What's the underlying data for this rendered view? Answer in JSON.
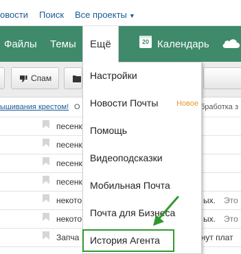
{
  "toplinks": {
    "news": "овости",
    "search": "Поиск",
    "all_projects": "Все проекты"
  },
  "nav": {
    "files": "Файлы",
    "topics": "Темы",
    "more": "Ещё",
    "calendar_day": "20",
    "calendar": "Календарь"
  },
  "toolbar": {
    "spam": "Спам"
  },
  "infostrip": {
    "link_text": "ышивания крестом!",
    "mid_text": "О",
    "right_text": "бработка з"
  },
  "rows": [
    {
      "subject": "песенк",
      "tail": "",
      "tail2": ""
    },
    {
      "subject": "песенк",
      "tail": "",
      "tail2": ""
    },
    {
      "subject": "песенк",
      "tail": "",
      "tail2": ""
    },
    {
      "subject": "песенк",
      "tail": "",
      "tail2": ""
    },
    {
      "subject": "некото",
      "tail": "ых.",
      "tail2": "Это"
    },
    {
      "subject": "некото",
      "tail": "ых.",
      "tail2": "Это"
    },
    {
      "subject": "Запча",
      "tail": "анут плат",
      "tail2": ""
    }
  ],
  "menu": {
    "items": [
      {
        "label": "Настройки"
      },
      {
        "label": "Новости Почты",
        "badge": "Новое"
      },
      {
        "label": "Помощь"
      },
      {
        "label": "Видеоподсказки"
      },
      {
        "label": "Мобильная Почта"
      },
      {
        "label": "Почта для Бизнеса"
      },
      {
        "label": "История Агента"
      }
    ]
  },
  "colors": {
    "nav_green": "#3e8a6b",
    "link_blue": "#1a5a96",
    "badge_orange": "#e39a2c",
    "highlight_green": "#2e9a2e"
  }
}
